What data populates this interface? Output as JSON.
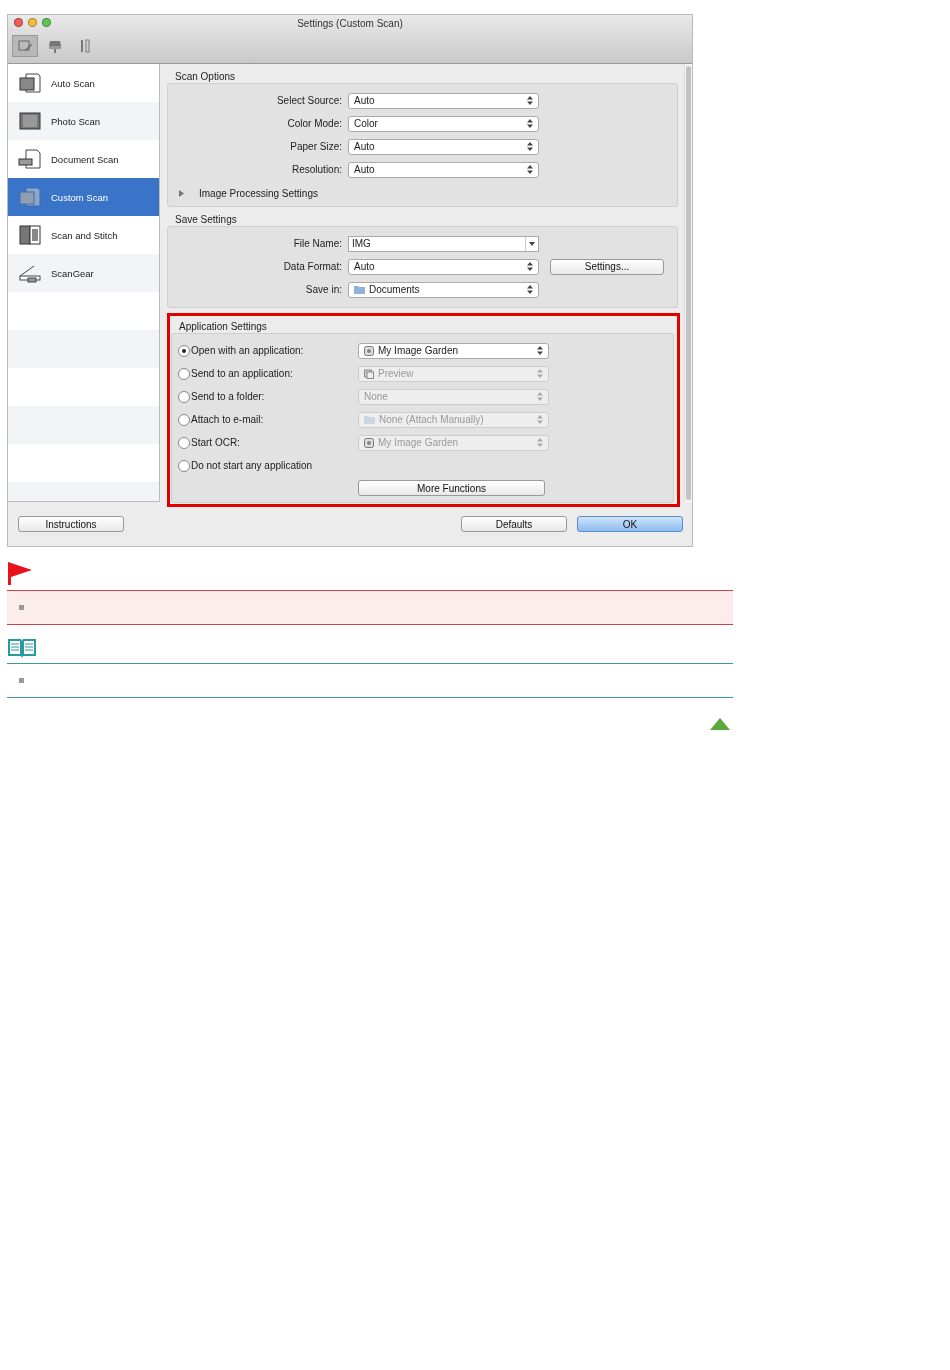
{
  "window": {
    "title": "Settings (Custom Scan)"
  },
  "toolbar": [
    {
      "kind": "scan",
      "selected": true
    },
    {
      "kind": "scanner",
      "selected": false
    },
    {
      "kind": "tools",
      "selected": false
    }
  ],
  "sidebar": {
    "items": [
      {
        "label": "Auto Scan",
        "kind": "auto",
        "selected": false
      },
      {
        "label": "Photo Scan",
        "kind": "photo",
        "selected": false
      },
      {
        "label": "Document Scan",
        "kind": "document",
        "selected": false
      },
      {
        "label": "Custom Scan",
        "kind": "custom",
        "selected": true
      },
      {
        "label": "Scan and Stitch",
        "kind": "stitch",
        "selected": false
      },
      {
        "label": "ScanGear",
        "kind": "scangear",
        "selected": false
      }
    ]
  },
  "scan_options": {
    "title": "Scan Options",
    "fields": [
      {
        "label": "Select Source:",
        "value": "Auto"
      },
      {
        "label": "Color Mode:",
        "value": "Color"
      },
      {
        "label": "Paper Size:",
        "value": "Auto"
      },
      {
        "label": "Resolution:",
        "value": "Auto"
      }
    ],
    "expander": {
      "label": "Image Processing Settings",
      "expanded": false
    }
  },
  "save_settings": {
    "title": "Save Settings",
    "file_name": {
      "label": "File Name:",
      "value": "IMG"
    },
    "data_format": {
      "label": "Data Format:",
      "value": "Auto",
      "button": "Settings..."
    },
    "save_in": {
      "label": "Save in:",
      "value": "Documents"
    }
  },
  "application_settings": {
    "title": "Application Settings",
    "options": [
      {
        "label": "Open with an application:",
        "selected": true,
        "value": "My Image Garden",
        "disabled": false
      },
      {
        "label": "Send to an application:",
        "selected": false,
        "value": "Preview",
        "disabled": true
      },
      {
        "label": "Send to a folder:",
        "selected": false,
        "value": "None",
        "disabled": true
      },
      {
        "label": "Attach to e-mail:",
        "selected": false,
        "value": "None (Attach Manually)",
        "disabled": true
      },
      {
        "label": "Start OCR:",
        "selected": false,
        "value": "My Image Garden",
        "disabled": true
      },
      {
        "label": "Do not start any application",
        "selected": false
      }
    ],
    "button": "More Functions"
  },
  "footer": {
    "left_button": "Instructions",
    "buttons": [
      {
        "label": "Defaults",
        "default": false
      },
      {
        "label": "OK",
        "default": true
      }
    ]
  }
}
